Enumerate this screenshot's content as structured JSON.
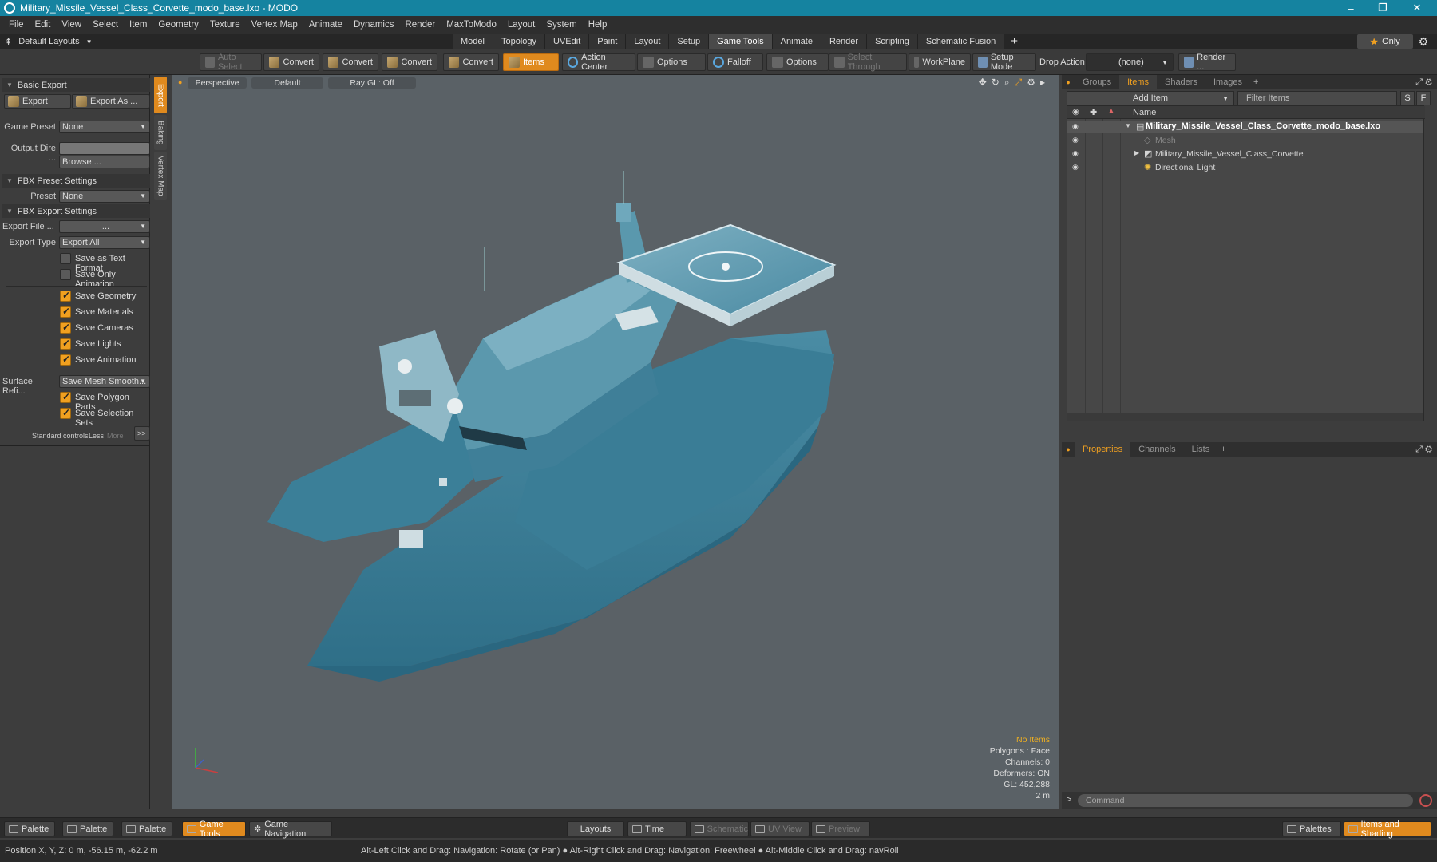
{
  "window": {
    "title": "Military_Missile_Vessel_Class_Corvette_modo_base.lxo - MODO"
  },
  "menu": [
    "File",
    "Edit",
    "View",
    "Select",
    "Item",
    "Geometry",
    "Texture",
    "Vertex Map",
    "Animate",
    "Dynamics",
    "Render",
    "MaxToModo",
    "Layout",
    "System",
    "Help"
  ],
  "layout_selector": "Default Layouts",
  "layout_tabs": [
    "Model",
    "Topology",
    "UVEdit",
    "Paint",
    "Layout",
    "Setup",
    "Game Tools",
    "Animate",
    "Render",
    "Scripting",
    "Schematic Fusion"
  ],
  "active_tab": "Game Tools",
  "only_label": "Only",
  "toolbar": {
    "auto_select": "Auto Select",
    "convert1": "Convert",
    "convert2": "Convert",
    "convert3": "Convert",
    "convert4": "Convert",
    "items": "Items",
    "action_center": "Action Center",
    "options1": "Options",
    "falloff": "Falloff",
    "options2": "Options",
    "select_through": "Select Through",
    "workplane": "WorkPlane",
    "setup_mode": "Setup Mode",
    "drop_action_label": "Drop Action",
    "drop_action_value": "(none)",
    "render": "Render ..."
  },
  "left_panel": {
    "basic_export": "Basic Export",
    "export_btn": "Export",
    "export_as_btn": "Export As ...",
    "game_preset_label": "Game Preset",
    "game_preset_value": "None",
    "output_dir_label": "Output Dire ...",
    "browse_btn": "Browse ...",
    "fbx_preset_settings": "FBX Preset Settings",
    "preset_label": "Preset",
    "preset_value": "None",
    "fbx_export_settings": "FBX Export Settings",
    "export_file_label": "Export File ...",
    "export_file_value": "...",
    "export_type_label": "Export Type",
    "export_type_value": "Export All",
    "save_text_format": "Save as Text Format",
    "save_only_animation": "Save Only Animation",
    "save_geometry": "Save Geometry",
    "save_materials": "Save Materials",
    "save_cameras": "Save Cameras",
    "save_lights": "Save Lights",
    "save_animation": "Save Animation",
    "surface_refine_label": "Surface Refi...",
    "surface_refine_value": "Save Mesh Smooth...",
    "save_polygon_parts": "Save Polygon Parts",
    "save_selection_sets": "Save Selection Sets",
    "standard_controls": "Standard controls",
    "less": "Less",
    "more": "More",
    "expand": ">>"
  },
  "side_tabs": [
    "Export",
    "Baking",
    "Vertex Map"
  ],
  "viewport": {
    "view": "Perspective",
    "shading": "Default",
    "raygl": "Ray GL: Off",
    "info": {
      "no_items": "No Items",
      "polygons": "Polygons : Face",
      "channels": "Channels: 0",
      "deformers": "Deformers: ON",
      "gl": "GL: 452,288",
      "scale": "2 m"
    }
  },
  "right_panel": {
    "tabs": [
      "Groups",
      "Items",
      "Shaders",
      "Images"
    ],
    "active_tab": "Items",
    "add_item": "Add Item",
    "filter_items": "Filter Items",
    "s_btn": "S",
    "f_btn": "F",
    "name_header": "Name",
    "tree": [
      {
        "label": "Military_Missile_Vessel_Class_Corvette_modo_base.lxo",
        "level": 0
      },
      {
        "label": "Mesh",
        "level": 1
      },
      {
        "label": "Military_Missile_Vessel_Class_Corvette",
        "level": 1
      },
      {
        "label": "Directional Light",
        "level": 1
      }
    ],
    "prop_tabs": [
      "Properties",
      "Channels",
      "Lists"
    ],
    "prop_active": "Properties",
    "command_placeholder": "Command"
  },
  "bottom_bar": {
    "palette1": "Palette",
    "palette2": "Palette",
    "palette3": "Palette",
    "game_tools": "Game Tools",
    "game_navigation": "Game Navigation",
    "layouts": "Layouts",
    "time": "Time",
    "schematic": "Schematic",
    "uv_view": "UV View",
    "preview": "Preview",
    "palettes": "Palettes",
    "items_and_shading": "Items and Shading"
  },
  "status": {
    "position": "Position X, Y, Z:  0 m, -56.15 m, -62.2 m",
    "hint": "Alt-Left Click and Drag: Navigation: Rotate (or Pan) ● Alt-Right Click and Drag: Navigation: Freewheel ● Alt-Middle Click and Drag: navRoll"
  },
  "colors": {
    "accent": "#e08a1e",
    "titlebar": "#1583a0",
    "ship": "#3d8098"
  }
}
